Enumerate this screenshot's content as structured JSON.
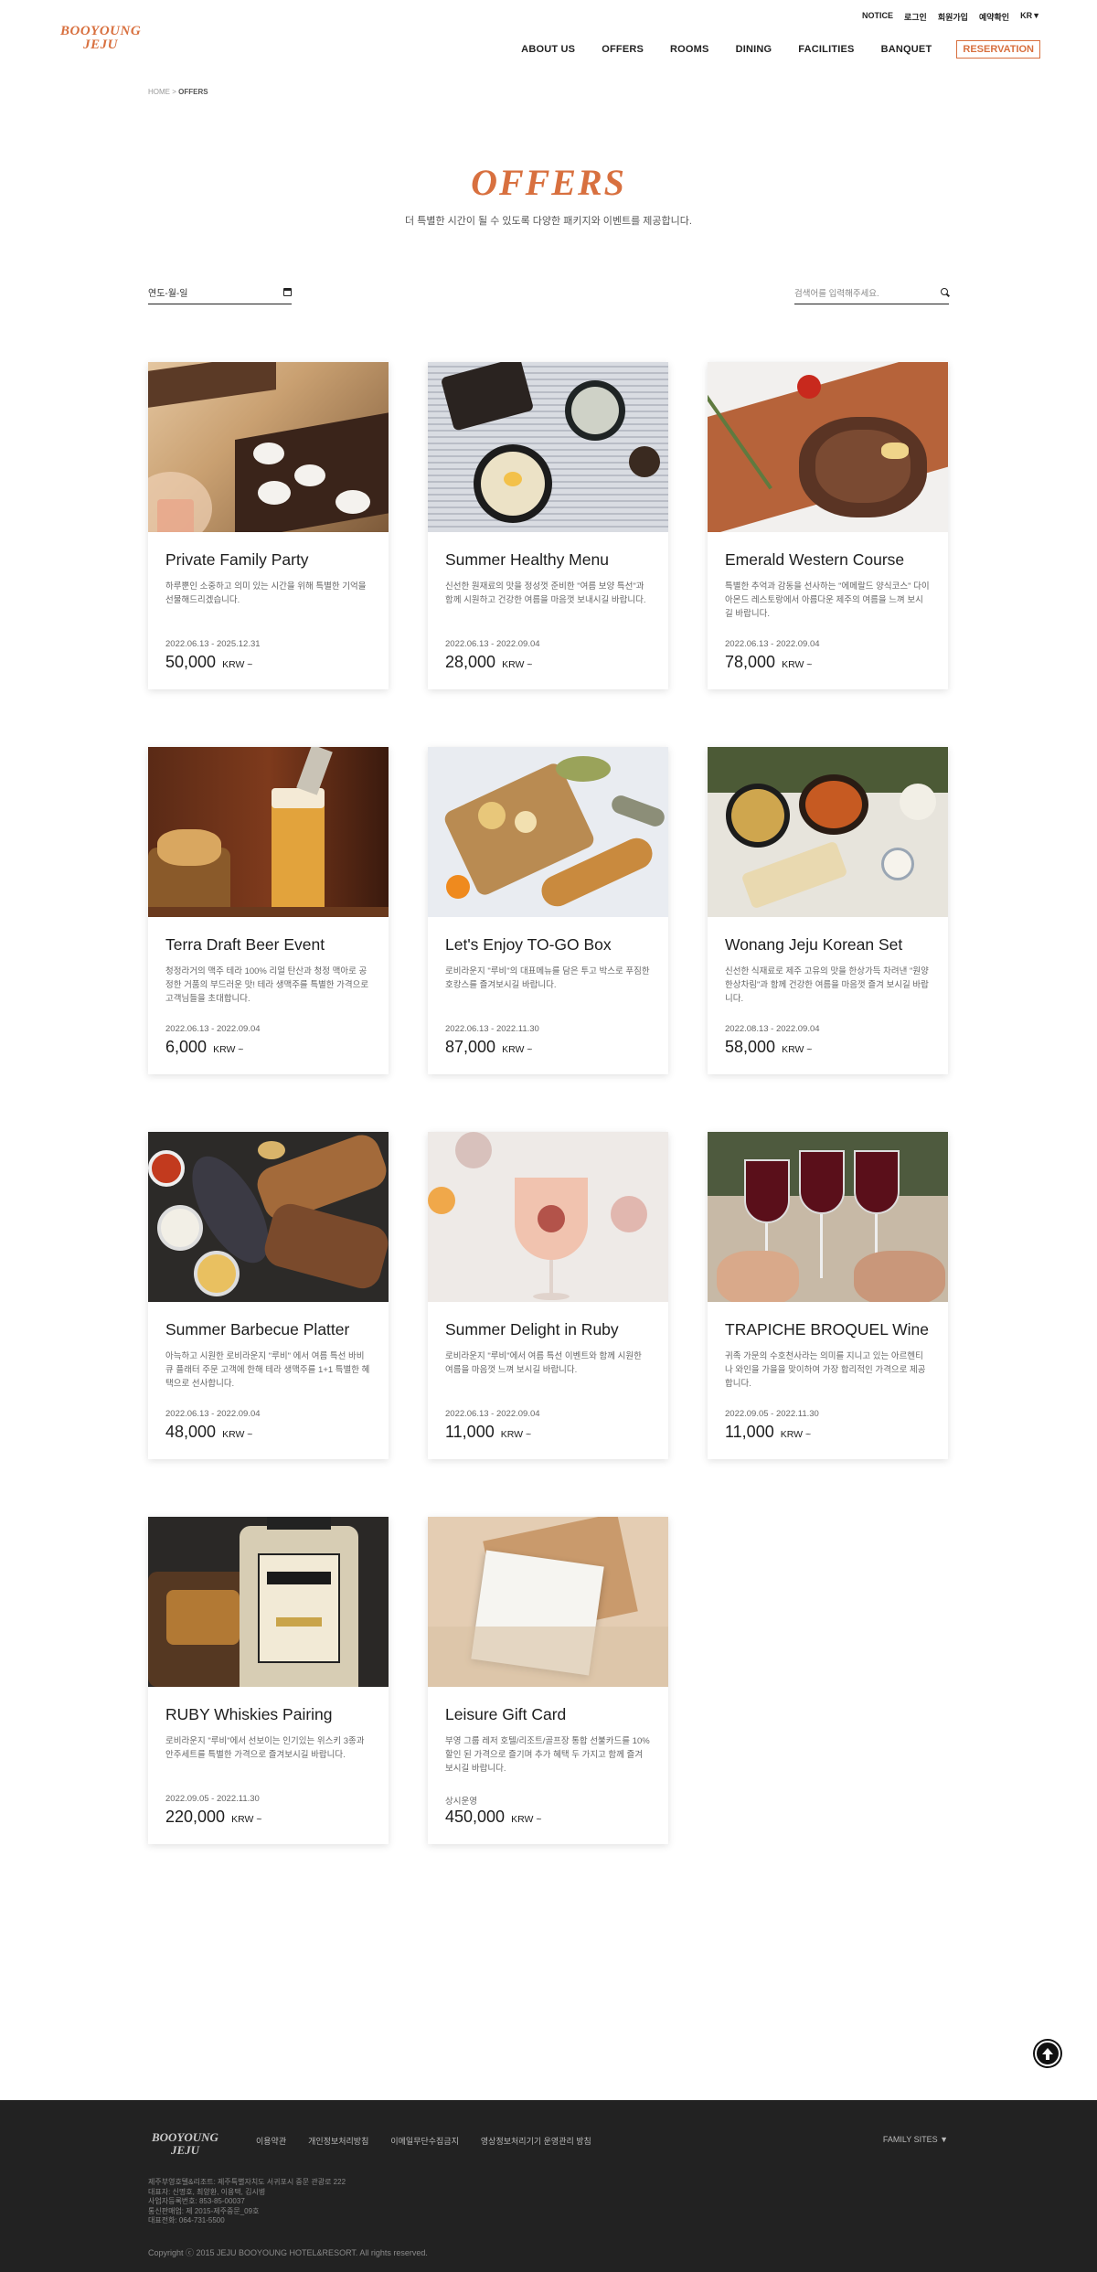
{
  "header": {
    "top_links": [
      "NOTICE",
      "로그인",
      "회원가입",
      "예약확인",
      "KR▼"
    ],
    "logo_line1": "BOOYOUNG",
    "logo_line2": "JEJU",
    "nav": [
      "ABOUT US",
      "OFFERS",
      "ROOMS",
      "DINING",
      "FACILITIES",
      "BANQUET"
    ],
    "reservation": "RESERVATION"
  },
  "breadcrumb": {
    "home": "HOME",
    "sep": " > ",
    "current": "OFFERS"
  },
  "page": {
    "title": "OFFERS",
    "subtitle": "더 특별한 시간이 될 수 있도록 다양한 패키지와 이벤트를 제공합니다."
  },
  "filters": {
    "date_placeholder": "연도-월-일",
    "search_placeholder": "검색어를 입력해주세요."
  },
  "offers": [
    {
      "title": "Private Family Party",
      "desc": "하루뿐인 소중하고 의미 있는 시간을 위해 특별한 기억을 선물해드리겠습니다.",
      "date": "2022.06.13 - 2025.12.31",
      "price": "50,000",
      "unit": "KRW ~"
    },
    {
      "title": "Summer Healthy Menu",
      "desc": "신선한 원재료의 맛을 정성껏 준비한 \"여름 보양 특선\"과 함께 시원하고 건강한 여름을 마음껏 보내시길 바랍니다.",
      "date": "2022.06.13 - 2022.09.04",
      "price": "28,000",
      "unit": "KRW ~"
    },
    {
      "title": "Emerald Western Course",
      "desc": "특별한 추억과 감동을 선사하는 \"에메랄드 양식코스\" 다이아몬드 레스토랑에서 아름다운 제주의 여름을 느껴 보시길 바랍니다.",
      "date": "2022.06.13 - 2022.09.04",
      "price": "78,000",
      "unit": "KRW ~"
    },
    {
      "title": "Terra Draft Beer Event",
      "desc": "청정라거의 맥주 테라 100% 리얼 탄산과 청정 맥아로 공정한 거품의 부드러운 맛! 테라 생맥주를 특별한 가격으로 고객님들을 초대합니다.",
      "date": "2022.06.13 - 2022.09.04",
      "price": "6,000",
      "unit": "KRW ~"
    },
    {
      "title": "Let's Enjoy TO-GO Box",
      "desc": "로비라운지 \"루비\"의 대표메뉴를 담은 투고 박스로 푸짐한 호캉스를 즐겨보시길 바랍니다.",
      "date": "2022.06.13 - 2022.11.30",
      "price": "87,000",
      "unit": "KRW ~"
    },
    {
      "title": "Wonang Jeju Korean Set",
      "desc": "신선한 식재료로 제주 고유의 맛을 한상가득 차려낸 \"원양 한상차림\"과 함께 건강한 여름을 마음껏 즐겨 보시길 바랍니다.",
      "date": "2022.08.13 - 2022.09.04",
      "price": "58,000",
      "unit": "KRW ~"
    },
    {
      "title": "Summer Barbecue Platter",
      "desc": "아늑하고 시원한 로비라운지 \"루비\" 에서 여름 특선 바비큐 플래터 주문 고객에 한해 테라 생맥주를 1+1 특별한 혜택으로 선사합니다.",
      "date": "2022.06.13 - 2022.09.04",
      "price": "48,000",
      "unit": "KRW ~"
    },
    {
      "title": "Summer Delight in Ruby",
      "desc": "로비라운지 \"루비\"에서 여름 특선 이벤트와 함께 시원한 여름을 마음껏 느껴 보시길 바랍니다.",
      "date": "2022.06.13 - 2022.09.04",
      "price": "11,000",
      "unit": "KRW ~"
    },
    {
      "title": "TRAPICHE BROQUEL Wine",
      "desc": "귀족 가문의 수호천사라는 의미를 지니고 있는 아르헨티나 와인을 가을을 맞이하여 가장 합리적인 가격으로 제공합니다.",
      "date": "2022.09.05 - 2022.11.30",
      "price": "11,000",
      "unit": "KRW ~"
    },
    {
      "title": "RUBY Whiskies Pairing",
      "desc": "로비라운지 \"루비\"에서 선보이는 인기있는 위스키 3종과 안주세트를 특별한 가격으로 즐겨보시길 바랍니다.",
      "date": "2022.09.05 - 2022.11.30",
      "price": "220,000",
      "unit": "KRW ~"
    },
    {
      "title": "Leisure Gift Card",
      "desc": "부영 그룹 레저 호텔/리조트/골프장 통합 선불카드를 10% 할인 된 가격으로 즐기며 추가 혜택 두 가지고 함께 즐겨 보시길 바랍니다.",
      "date": "상시운영",
      "price": "450,000",
      "unit": "KRW ~"
    }
  ],
  "footer": {
    "logo_line1": "BOOYOUNG",
    "logo_line2": "JEJU",
    "links": [
      "이용약관",
      "개인정보처리방침",
      "이메일무단수집금지",
      "영상정보처리기기 운영관리 방침"
    ],
    "family_sites": "FAMILY SITES ▼",
    "info": [
      "제주부영호텔&리조트: 제주특별자치도 서귀포시 중문 관광로 222",
      "대표자: 신명호, 최양환, 이용택, 김시병",
      "사업자등록번호: 853-85-00037",
      "통신판매업: 제 2015-제주중문_09호",
      "대표전화: 064-731-5500"
    ],
    "copyright": "Copyright ⓒ 2015 JEJU BOOYOUNG HOTEL&RESORT. All rights reserved."
  }
}
